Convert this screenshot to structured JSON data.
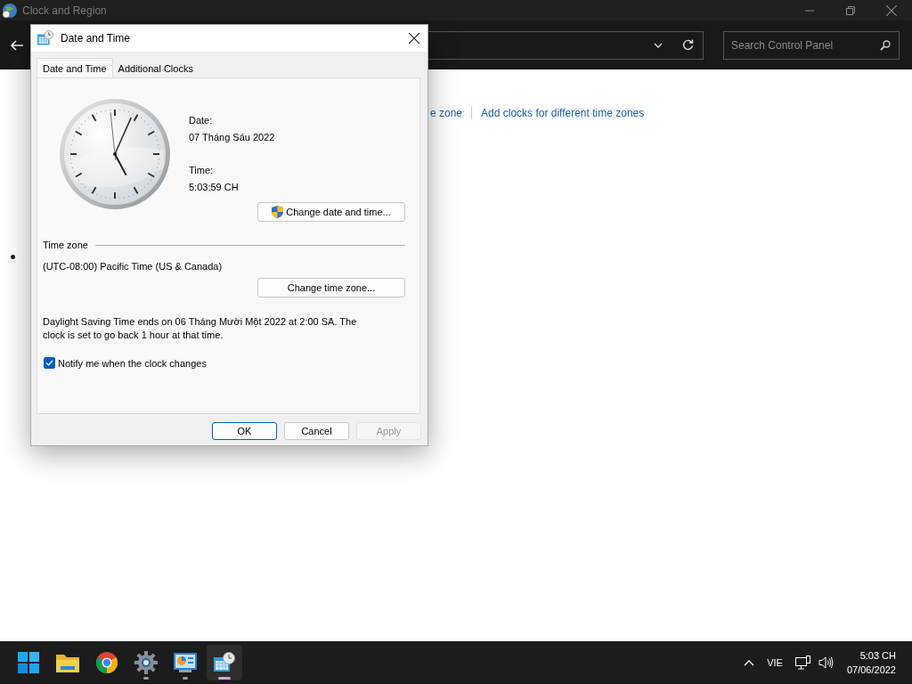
{
  "main_window": {
    "title": "Clock and Region",
    "search": {
      "placeholder": "Search Control Panel"
    },
    "links": [
      "e zone",
      "Add clocks for different time zones"
    ]
  },
  "dialog": {
    "title": "Date and Time",
    "tabs": [
      {
        "label": "Date and Time",
        "selected": true
      },
      {
        "label": "Additional Clocks",
        "selected": false
      }
    ],
    "date_label": "Date:",
    "date": "07 Tháng Sáu 2022",
    "time_label": "Time:",
    "time": "5:03:59 CH",
    "change_datetime_button": "Change date and time...",
    "time_zone_heading": "Time zone",
    "time_zone": "(UTC-08:00) Pacific Time (US & Canada)",
    "change_timezone_button": "Change time zone...",
    "dst_note": "Daylight Saving Time ends on 06 Tháng Mười Một 2022 at 2:00 SA. The clock is set to go back 1 hour at that time.",
    "notify": {
      "label": "Notify me when the clock changes",
      "checked": true
    },
    "buttons": [
      {
        "label": "OK",
        "kind": "default",
        "disabled": false
      },
      {
        "label": "Cancel",
        "kind": "normal",
        "disabled": false
      },
      {
        "label": "Apply",
        "kind": "normal",
        "disabled": true
      }
    ]
  },
  "taskbar": {
    "apps": [
      {
        "kind": "start",
        "running": false,
        "active": false
      },
      {
        "kind": "folder",
        "running": false,
        "active": false
      },
      {
        "kind": "browser",
        "running": false,
        "active": false
      },
      {
        "kind": "settings",
        "running": true,
        "active": false
      },
      {
        "kind": "control-panel",
        "running": true,
        "active": false
      },
      {
        "kind": "datetime",
        "running": true,
        "active": true
      }
    ],
    "language": "VIE",
    "time": "5:03 CH",
    "date": "07/06/2022"
  }
}
